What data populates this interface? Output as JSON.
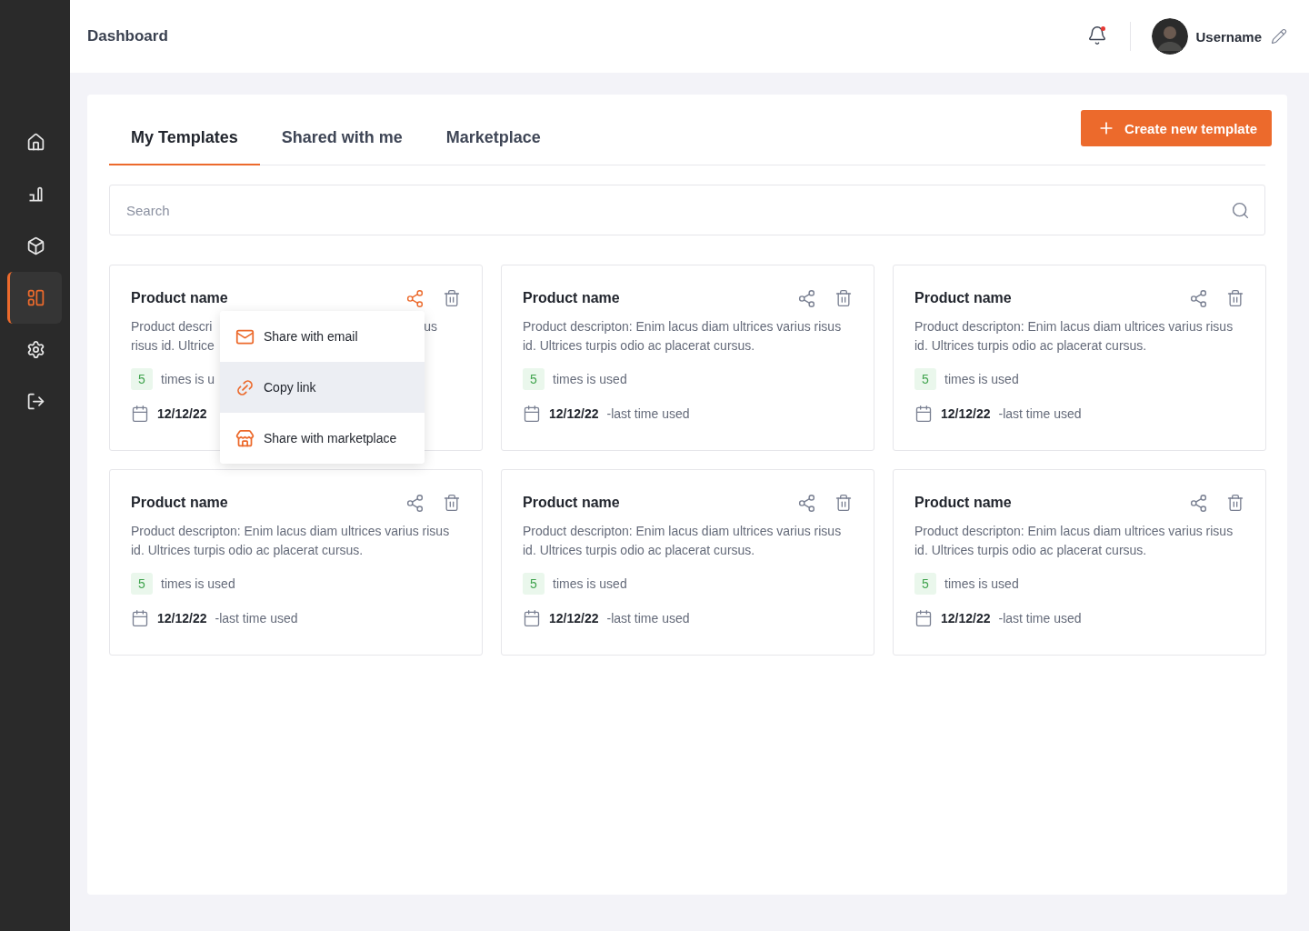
{
  "sidebar": {
    "items": [
      {
        "selected": false
      },
      {
        "selected": false
      },
      {
        "selected": false
      },
      {
        "selected": true
      },
      {
        "selected": false
      },
      {
        "selected": false
      }
    ]
  },
  "header": {
    "title": "Dashboard",
    "notification": true,
    "username": "Username"
  },
  "tabs": [
    {
      "label": "My Templates",
      "selected": true
    },
    {
      "label": "Shared with me",
      "selected": false
    },
    {
      "label": "Marketplace",
      "selected": false
    }
  ],
  "create_button": "Create new template",
  "search": {
    "placeholder": "Search"
  },
  "cards": [
    {
      "kind": "covered",
      "name": "Product name",
      "description_lines": [
        [
          "Product descri",
          "us"
        ],
        [
          "risus id. Ultrice"
        ]
      ],
      "count": "5",
      "count_label": "times is u",
      "date": "12/12/22",
      "share_open": true
    },
    {
      "kind": "full",
      "name": "Product name",
      "description": "Product descripton: Enim lacus diam ultrices varius risus id. Ultrices turpis odio ac placerat cursus.",
      "count": "5",
      "count_label": "times is used",
      "date": "12/12/22",
      "date_label": "-last time used",
      "share_open": false
    },
    {
      "kind": "full",
      "name": "Product name",
      "description": "Product descripton: Enim lacus diam ultrices varius risus id. Ultrices turpis odio ac placerat cursus.",
      "count": "5",
      "count_label": "times is used",
      "date": "12/12/22",
      "date_label": "-last time used",
      "share_open": false
    },
    {
      "kind": "full",
      "name": "Product name",
      "description": "Product descripton: Enim lacus diam ultrices varius risus id. Ultrices turpis odio ac placerat cursus.",
      "count": "5",
      "count_label": "times is used",
      "date": "12/12/22",
      "date_label": "-last time used",
      "share_open": false
    },
    {
      "kind": "full",
      "name": "Product name",
      "description": "Product descripton: Enim lacus diam ultrices varius risus id. Ultrices turpis odio ac placerat cursus.",
      "count": "5",
      "count_label": "times is used",
      "date": "12/12/22",
      "date_label": "-last time used",
      "share_open": false
    },
    {
      "kind": "full",
      "name": "Product name",
      "description": "Product descripton: Enim lacus diam ultrices varius risus id. Ultrices turpis odio ac placerat cursus.",
      "count": "5",
      "count_label": "times is used",
      "date": "12/12/22",
      "date_label": "-last time used",
      "share_open": false
    }
  ],
  "share_menu": {
    "items": [
      {
        "label": "Share with email",
        "selected": false
      },
      {
        "label": "Copy link",
        "selected": true
      },
      {
        "label": "Share with marketplace",
        "selected": false
      }
    ]
  }
}
